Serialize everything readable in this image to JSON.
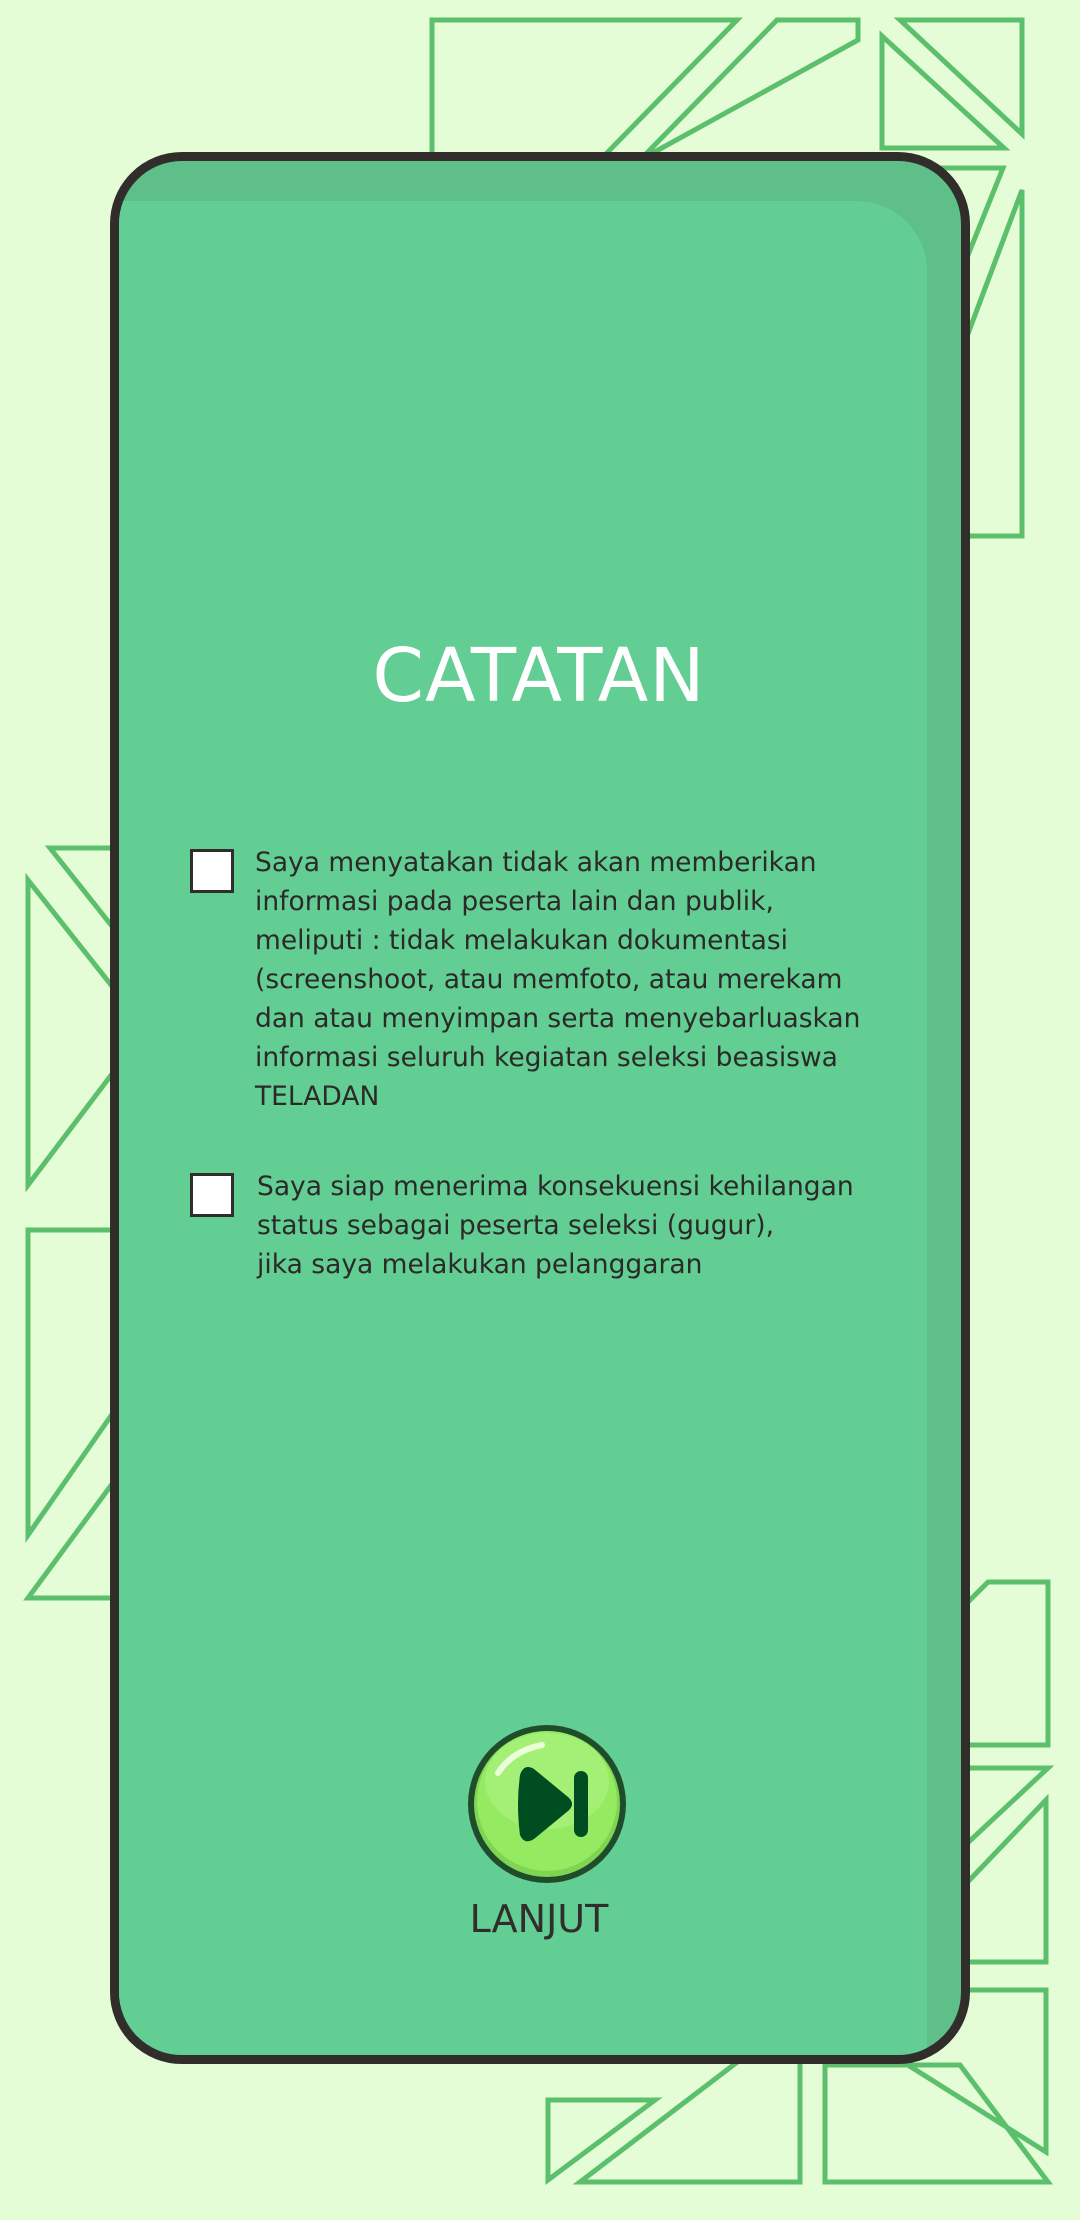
{
  "notes": {
    "title": "CATATAN",
    "statements": [
      {
        "checked": false,
        "text": "Saya menyatakan tidak akan memberikan\ninformasi pada peserta lain dan publik,\nmeliputi : tidak melakukan dokumentasi\n(screenshoot, atau memfoto, atau merekam\ndan atau menyimpan serta menyebarluaskan\ninformasi seluruh kegiatan seleksi beasiswa\nTELADAN"
      },
      {
        "checked": false,
        "text": "Saya siap menerima konsekuensi kehilangan\nstatus sebagai peserta seleksi (gugur),\njika saya melakukan pelanggaran"
      }
    ],
    "next_button": {
      "label": "LANJUT",
      "icon": "skip-next-icon"
    }
  },
  "colors": {
    "background": "#e4fdd6",
    "shape_outline": "#5cbf6c",
    "card": "#63ce94",
    "card_shade": "#5fbf88",
    "card_border": "#302d2b",
    "title_text": "#ffffff",
    "button_green": "#94ea60"
  }
}
